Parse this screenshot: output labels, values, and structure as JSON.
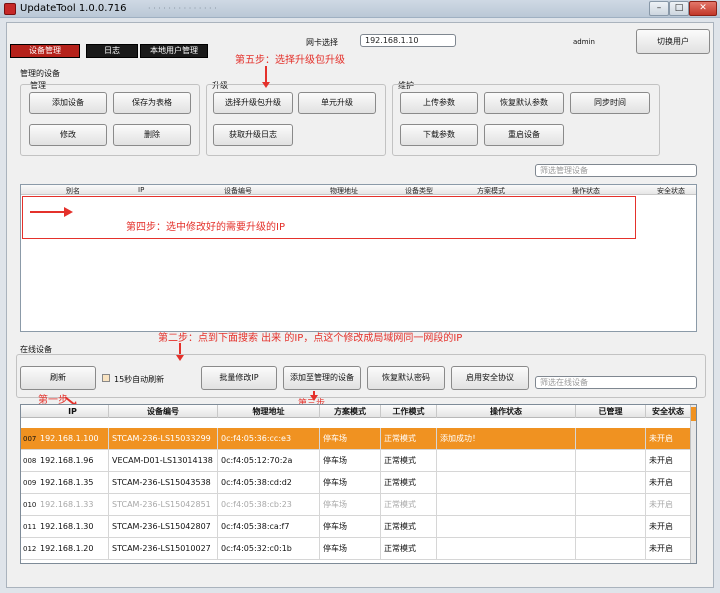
{
  "window": {
    "title": "UpdateTool  1.0.0.716",
    "subtitle_blurred": "· · · · · · · · · · · · · ·",
    "min_glyph": "–",
    "max_glyph": "□",
    "close_glyph": "✕"
  },
  "tabs": [
    {
      "label": "设备管理"
    },
    {
      "label": "日志"
    },
    {
      "label": "本地用户管理"
    }
  ],
  "header": {
    "nic_label": "网卡选择",
    "nic_value": "192.168.1.10",
    "user": "admin",
    "switch_user_label": "切换用户"
  },
  "managed": {
    "section_label": "管理的设备",
    "manage_group": {
      "label": "管理",
      "add_label": "添加设备",
      "save_table_label": "保存为表格",
      "modify_label": "修改",
      "delete_label": "删除"
    },
    "upgrade_group": {
      "label": "升级",
      "select_package_label": "选择升级包升级",
      "unit_upgrade_label": "单元升级",
      "get_log_label": "获取升级日志"
    },
    "maintain_group": {
      "label": "维护",
      "upload_params_label": "上传参数",
      "restore_default_label": "恢复默认参数",
      "sync_time_label": "同步时间",
      "download_params_label": "下载参数",
      "restart_label": "重启设备"
    },
    "filter_placeholder": "筛选管理设备",
    "columns": [
      "别名",
      "IP",
      "设备编号",
      "物理地址",
      "设备类型",
      "方案模式",
      "操作状态",
      "安全状态"
    ]
  },
  "online": {
    "section_label": "在线设备",
    "refresh_label": "刷新",
    "auto_refresh_label": "15秒自动刷新",
    "batch_ip_label": "批量修改IP",
    "add_to_managed_label": "添加至管理的设备",
    "restore_password_label": "恢复默认密码",
    "enable_security_label": "启用安全协议",
    "filter_placeholder": "筛选在线设备",
    "columns": [
      "IP",
      "设备编号",
      "物理地址",
      "方案模式",
      "工作模式",
      "操作状态",
      "已管理",
      "安全状态"
    ],
    "rows": [
      {
        "num": "007",
        "ip": "192.168.1.100",
        "sn": "STCAM-236-LS15033299",
        "mac": "0c:f4:05:36:cc:e3",
        "scheme": "停车场",
        "work": "正常模式",
        "op": "添加成功！",
        "managed": "",
        "sec": "未开启"
      },
      {
        "num": "008",
        "ip": "192.168.1.96",
        "sn": "VECAM-D01-LS13014138",
        "mac": "0c:f4:05:12:70:2a",
        "scheme": "停车场",
        "work": "正常模式",
        "op": "",
        "managed": "",
        "sec": "未开启"
      },
      {
        "num": "009",
        "ip": "192.168.1.35",
        "sn": "STCAM-236-LS15043538",
        "mac": "0c:f4:05:38:cd:d2",
        "scheme": "停车场",
        "work": "正常模式",
        "op": "",
        "managed": "",
        "sec": "未开启"
      },
      {
        "num": "010",
        "ip": "192.168.1.33",
        "sn": "STCAM-236-LS15042851",
        "mac": "0c:f4:05:38:cb:23",
        "scheme": "停车场",
        "work": "正常模式",
        "op": "",
        "managed": "",
        "sec": "未开启"
      },
      {
        "num": "011",
        "ip": "192.168.1.30",
        "sn": "STCAM-236-LS15042807",
        "mac": "0c:f4:05:38:ca:f7",
        "scheme": "停车场",
        "work": "正常模式",
        "op": "",
        "managed": "",
        "sec": "未开启"
      },
      {
        "num": "012",
        "ip": "192.168.1.20",
        "sn": "STCAM-236-LS15010027",
        "mac": "0c:f4:05:32:c0:1b",
        "scheme": "停车场",
        "work": "正常模式",
        "op": "",
        "managed": "",
        "sec": "未开启"
      }
    ]
  },
  "annotations": {
    "step1": "第一步",
    "step2": "第二步：点到下面搜索 出来 的IP，点这个修改成局域网同一网段的IP",
    "step3": "第三步",
    "step4": "第四步：选中修改好的需要升级的IP",
    "step5": "第五步：选择升级包升级"
  },
  "colors": {
    "accent_red": "#e4312b",
    "selected_row": "#f09221",
    "active_tab": "#b5221b"
  }
}
